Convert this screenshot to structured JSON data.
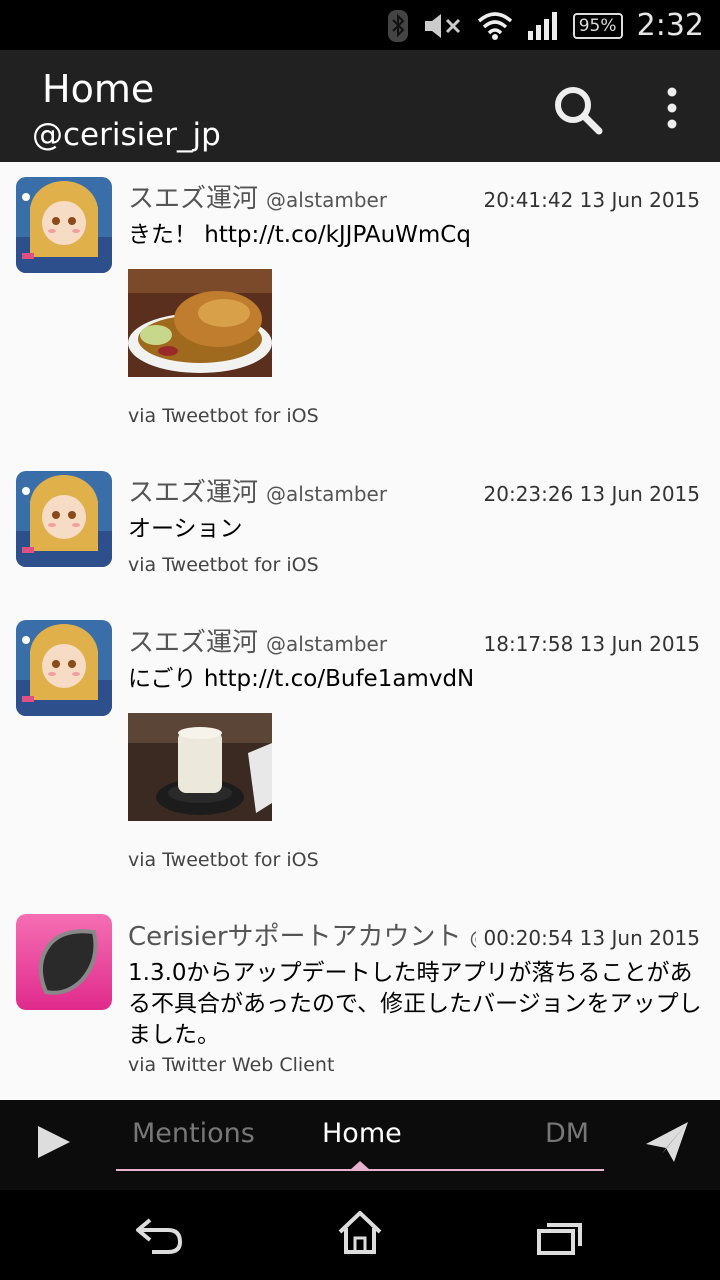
{
  "status_bar": {
    "battery": "95%",
    "time": "2:32"
  },
  "app_bar": {
    "title": "Home",
    "account": "@cerisier_jp"
  },
  "tweets": [
    {
      "name": "スエズ運河",
      "handle": "@alstamber",
      "time": "20:41:42 13 Jun 2015",
      "text": "きた！ http://t.co/kJJPAuWmCq",
      "via": "via Tweetbot for iOS"
    },
    {
      "name": "スエズ運河",
      "handle": "@alstamber",
      "time": "20:23:26 13 Jun 2015",
      "text": "オーション",
      "via": "via Tweetbot for iOS"
    },
    {
      "name": "スエズ運河",
      "handle": "@alstamber",
      "time": "18:17:58 13 Jun 2015",
      "text": "にごり http://t.co/Bufe1amvdN",
      "via": "via Tweetbot for iOS"
    },
    {
      "name": "Cerisierサポートアカウント",
      "handle": "@...",
      "time": "00:20:54 13 Jun 2015",
      "text": "1.3.0からアップデートした時アプリが落ちることがある不具合があったので、修正したバージョンをアップしました。",
      "via": "via Twitter Web Client"
    }
  ],
  "tabs": {
    "mentions": "Mentions",
    "home": "Home",
    "dm": "DM"
  },
  "colors": {
    "app_bar": "#212121",
    "timeline_bg": "#fafafa",
    "tab_indicator": "#e7b1cd",
    "active_tab": "#ffffff",
    "inactive_tab": "#777777",
    "cerisier_avatar": "#e8399a"
  },
  "icons": [
    "bluetooth-icon",
    "mute-icon",
    "wifi-icon",
    "signal-icon",
    "battery-icon",
    "search-icon",
    "overflow-menu-icon",
    "play-icon",
    "send-icon",
    "back-icon",
    "home-icon",
    "recents-icon"
  ]
}
